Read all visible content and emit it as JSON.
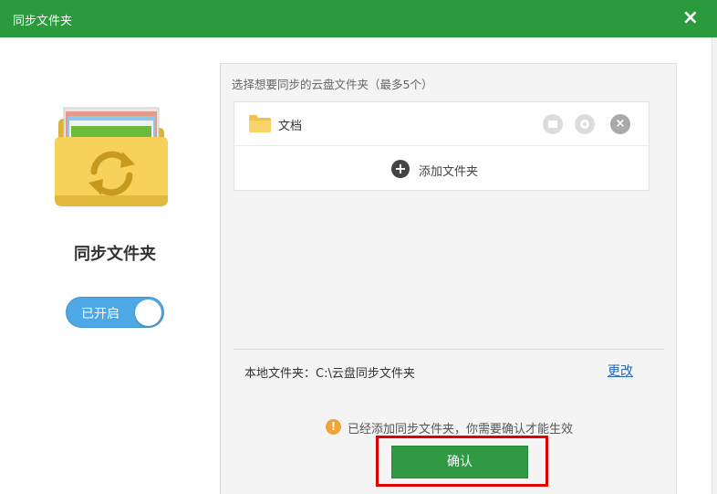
{
  "window": {
    "title": "同步文件夹",
    "close_symbol": "×"
  },
  "left": {
    "feature_title": "同步文件夹",
    "toggle_label": "已开启",
    "toggle_on": true
  },
  "panel": {
    "hint": "选择想要同步的云盘文件夹（最多5个）",
    "folders": [
      {
        "name": "文档"
      }
    ],
    "add_label": "添加文件夹",
    "local_folder_label": "本地文件夹：C:\\云盘同步文件夹",
    "change_link": "更改",
    "notice": "已经添加同步文件夹，你需要确认才能生效",
    "confirm_label": "确认"
  },
  "icons": {
    "sync_folder": "sync-folder-icon",
    "folder": "folder-icon",
    "open": "open-folder-icon",
    "settings": "gear-icon",
    "remove": "close-icon",
    "add": "plus-circle-icon",
    "notice": "info-icon"
  },
  "colors": {
    "titlebar": "#2a9a3c",
    "confirm": "#2f9a43",
    "toggle": "#4fa8e6",
    "link": "#2866b8",
    "highlight": "#e00000",
    "notice_icon": "#f3a333"
  }
}
